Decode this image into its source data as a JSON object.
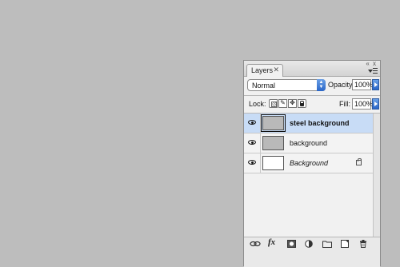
{
  "panel": {
    "tab_label": "Layers",
    "tab_close_glyph": "✕",
    "top_controls": "« x"
  },
  "blend": {
    "mode": "Normal",
    "opacity_label": "Opacity:",
    "opacity_value": "100%"
  },
  "lock": {
    "label": "Lock:",
    "fill_label": "Fill:",
    "fill_value": "100%"
  },
  "layers": [
    {
      "name": "steel background",
      "style": "bold",
      "thumbnail": "grey",
      "selected": true,
      "visible": true
    },
    {
      "name": "background",
      "style": "normal",
      "thumbnail": "grey",
      "selected": false,
      "visible": true
    },
    {
      "name": "Background",
      "style": "italic",
      "thumbnail": "white",
      "selected": false,
      "visible": true,
      "locked": true
    }
  ],
  "bottom_tools": [
    {
      "icon": "link-icon"
    },
    {
      "icon": "fx-icon",
      "label": "fx"
    },
    {
      "icon": "mask-icon"
    },
    {
      "icon": "adjustment-layer-icon"
    },
    {
      "icon": "folder-icon"
    },
    {
      "icon": "new-layer-icon"
    },
    {
      "icon": "trash-icon"
    }
  ],
  "colors": {
    "background": "#bdbdbd",
    "selected_row": "#c8dcf6",
    "accent": "#2a66c8"
  }
}
